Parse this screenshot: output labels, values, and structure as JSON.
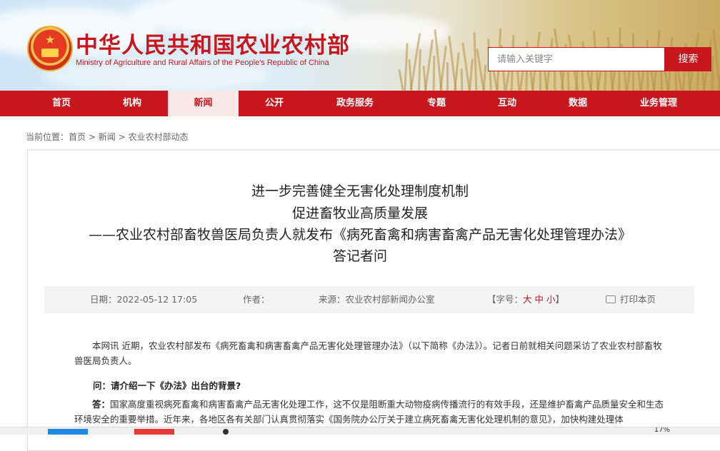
{
  "header": {
    "ministry_cn": "中华人民共和国农业农村部",
    "ministry_en": "Ministry of Agriculture and Rural Affairs of the People's Republic of China",
    "search_placeholder": "请输入关键字",
    "search_button": "搜索"
  },
  "nav": {
    "items": [
      {
        "label": "首页"
      },
      {
        "label": "机构"
      },
      {
        "label": "新闻",
        "active": true
      },
      {
        "label": "公开"
      },
      {
        "label": "政务服务"
      },
      {
        "label": "专题"
      },
      {
        "label": "互动"
      },
      {
        "label": "数据"
      },
      {
        "label": "业务管理"
      }
    ]
  },
  "breadcrumb": {
    "prefix": "当前位置：",
    "items": [
      "首页",
      "新闻",
      "农业农村部动态"
    ],
    "separator": ">"
  },
  "article": {
    "title_lines": [
      "进一步完善健全无害化处理制度机制",
      "促进畜牧业高质量发展",
      "——农业农村部畜牧兽医局负责人就发布《病死畜禽和病害畜禽产品无害化处理管理办法》",
      "答记者问"
    ],
    "meta": {
      "date_label": "日期：",
      "date": "2022-05-12 17:05",
      "author_label": "作者：",
      "source_label": "来源：",
      "source": "农业农村部新闻办公室",
      "font_size_label": "【字号：",
      "size_large": "大",
      "size_medium": "中",
      "size_small": "小",
      "font_size_end": "】",
      "print_label": "打印本页"
    },
    "intro": "本网讯 近期，农业农村部发布《病死畜禽和病害畜禽产品无害化处理管理办法》（以下简称《办法》）。记者日前就相关问题采访了农业农村部畜牧兽医局负责人。",
    "question1": "问：请介绍一下《办法》出台的背景?",
    "answer_label": "答：",
    "answer1": "国家高度重视病死畜禽和病害畜禽产品无害化处理工作，这不仅是阻断重大动物疫病传播流行的有效手段，还是维护畜禽产品质量安全和生态环境安全的重要举措。近年来，各地区各有关部门认真贯彻落实《国务院办公厅关于建立病死畜禽无害化处理机制的意见》，加快构建处理体"
  },
  "taskbar": {
    "zoom": "17%"
  },
  "colors": {
    "brand_red": "#c8161d",
    "nav_active_bg": "#fbe9e9"
  }
}
